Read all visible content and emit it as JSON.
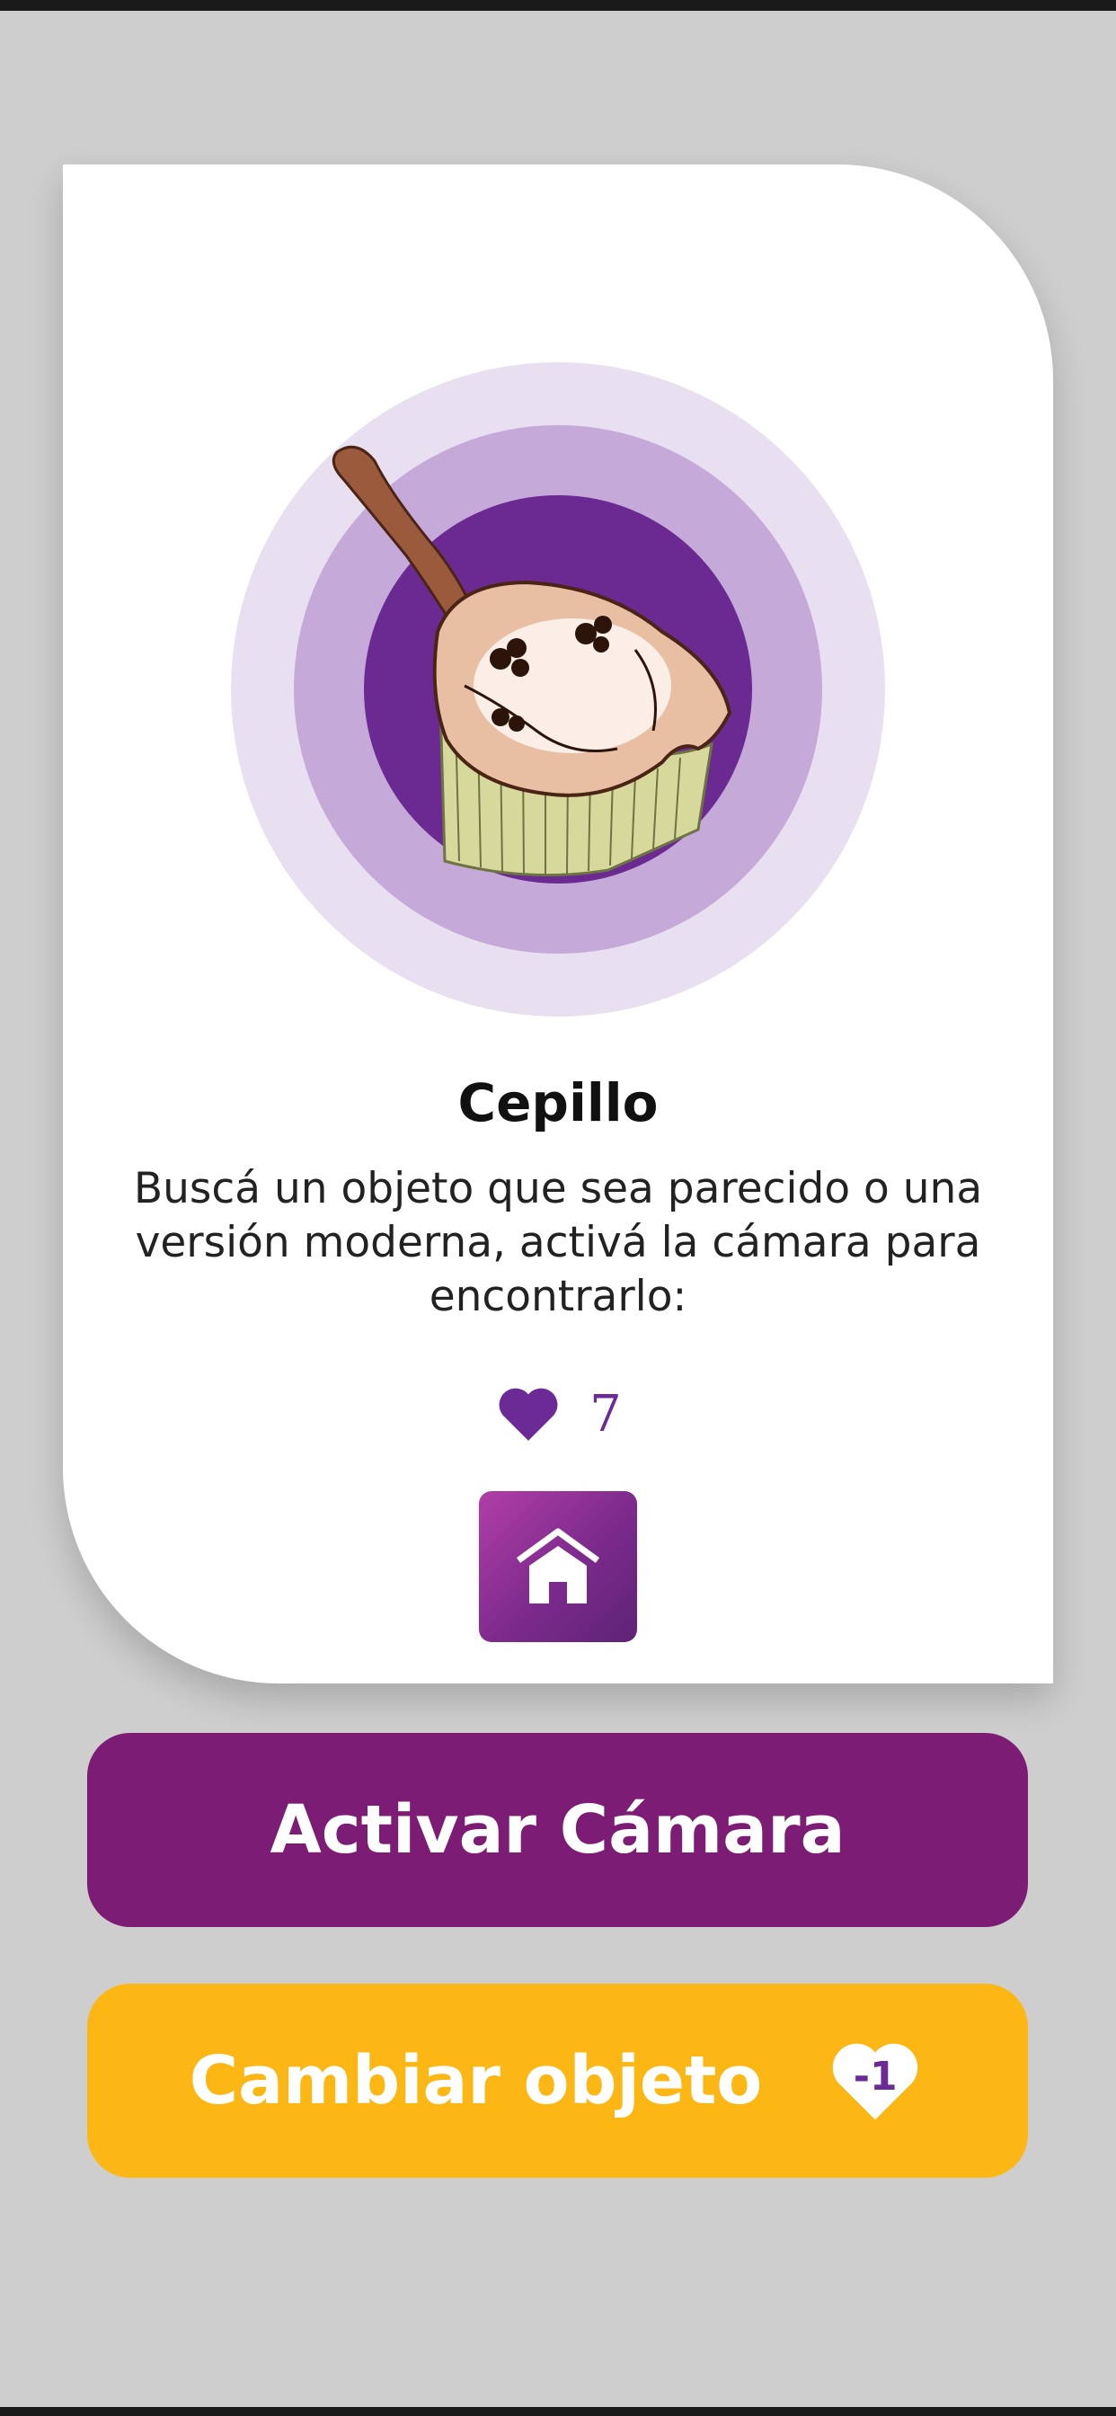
{
  "card": {
    "object_name": "Cepillo",
    "instructions": "Buscá un objeto que sea parecido o una versión moderna, activá la cámara para encontrarlo:",
    "lives_count": "7",
    "illustration_icon": "brush-icon",
    "home_icon": "home-icon"
  },
  "buttons": {
    "camera_label": "Activar Cámara",
    "change_label": "Cambiar objeto",
    "change_cost": "-1"
  },
  "colors": {
    "background": "#cecece",
    "card": "#ffffff",
    "primary_purple": "#7d1c75",
    "accent_yellow": "#fdb714",
    "heart_purple": "#6b2a96",
    "ring_outer": "#e8dff0",
    "ring_middle": "#c5a9d8",
    "ring_inner": "#6a2a91"
  }
}
